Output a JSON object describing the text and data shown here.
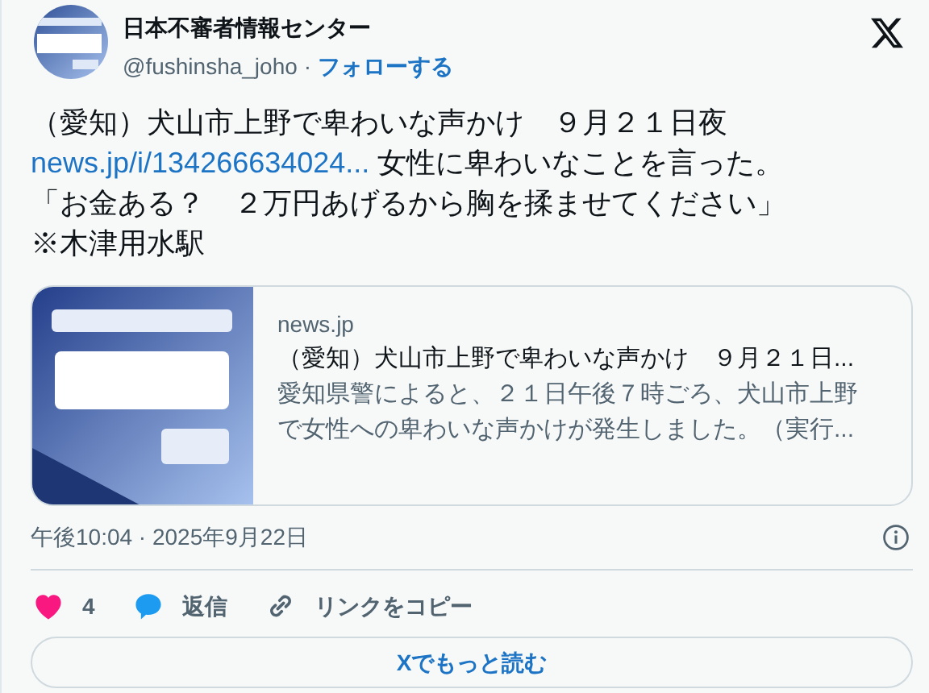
{
  "author": {
    "name": "日本不審者情報センター",
    "handle": "@fushinsha_joho",
    "separator": "·",
    "follow": "フォローする"
  },
  "body": [
    {
      "text": "（愛知）犬山市上野で卑わいな声かけ　９月２１日夜"
    },
    {
      "link": "news.jp/i/134266634024...",
      "text": " 女性に卑わいなことを言った。"
    },
    {
      "text": "「お金ある？　２万円あげるから胸を揉ませてください」"
    },
    {
      "text": "※木津用水駅"
    }
  ],
  "card": {
    "domain": "news.jp",
    "title": "（愛知）犬山市上野で卑わいな声かけ　９月２１日...",
    "description": [
      "愛知県警によると、２１日午後７時ごろ、犬山市上野",
      "で女性への卑わいな声かけが発生しました。（実行..."
    ]
  },
  "timestamp": "午後10:04 · 2025年9月22日",
  "actions": [
    {
      "kind": "like",
      "label": "4"
    },
    {
      "kind": "reply",
      "label": "返信"
    },
    {
      "kind": "copy",
      "label": "リンクをコピー"
    }
  ],
  "read_more": "Xでもっと読む"
}
